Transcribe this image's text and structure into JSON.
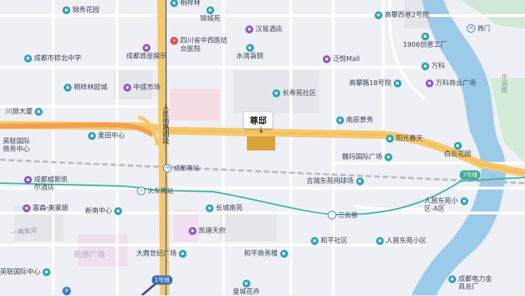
{
  "destination": {
    "label": "尊邸"
  },
  "colors": {
    "teal": "#2fa6b8",
    "purple": "#8d5ac8",
    "road": "#f6c86c",
    "metro": "#35b7a7",
    "river": "#8fc7ea"
  },
  "pois": [
    {
      "label": "锦秀花园",
      "type": "teal"
    },
    {
      "label": "桐梓林",
      "type": "teal"
    },
    {
      "label": "锦城苑",
      "type": "teal"
    },
    {
      "label": "高攀西巷2号院",
      "type": "teal"
    },
    {
      "label": "四川省中西医结合医院",
      "type": "red"
    },
    {
      "label": "汉易酒店",
      "type": "purple"
    },
    {
      "label": "成都市棕北中学",
      "type": "teal"
    },
    {
      "label": "成都首座娱乐",
      "type": "purple"
    },
    {
      "label": "水滴袅铜",
      "type": "teal"
    },
    {
      "label": "泛悦Mall",
      "type": "purple"
    },
    {
      "label": "1906创意工厂",
      "type": "teal"
    },
    {
      "label": "万科",
      "type": "teal"
    },
    {
      "label": "桐梓林欧城",
      "type": "teal"
    },
    {
      "label": "中成市场",
      "type": "purple"
    },
    {
      "label": "长寿苑社区",
      "type": "teal"
    },
    {
      "label": "高攀路18号院",
      "type": "teal"
    },
    {
      "label": "万科商业广场",
      "type": "purple"
    },
    {
      "label": "川旅大厦",
      "type": "teal"
    },
    {
      "label": "南辰景秀",
      "type": "teal"
    },
    {
      "label": "阳光春天",
      "type": "teal"
    },
    {
      "label": "麦田中心",
      "type": "teal"
    },
    {
      "label": "魏玛国际广场",
      "type": "teal"
    },
    {
      "label": "白云花园",
      "type": "teal"
    },
    {
      "label": "英联国际商务中心",
      "type": "teal"
    },
    {
      "label": "成都威斯凯尔酒店",
      "type": "purple"
    },
    {
      "label": "吉瑞东苑网球场",
      "type": "teal"
    },
    {
      "label": "富森·美家居",
      "type": "purple"
    },
    {
      "label": "新南中心",
      "type": "teal"
    },
    {
      "label": "长城南苑",
      "type": "teal"
    },
    {
      "label": "人居东苑小区-A区",
      "type": "teal"
    },
    {
      "label": "凯德天府",
      "type": "purple"
    },
    {
      "label": "和平社区",
      "type": "teal"
    },
    {
      "label": "人居东苑小区",
      "type": "teal"
    },
    {
      "label": "大鼎世纪广场",
      "type": "teal"
    },
    {
      "label": "和平商务楼",
      "type": "teal"
    },
    {
      "label": "英联国际中心",
      "type": "teal"
    },
    {
      "label": "成都电力金具总厂",
      "type": "teal"
    },
    {
      "label": "皇城花卉",
      "type": "teal"
    }
  ],
  "stations": [
    {
      "label": "成都南站"
    },
    {
      "label": "火车南站"
    },
    {
      "label": "三瓦窑"
    },
    {
      "label": "西门"
    }
  ],
  "areas": {
    "kaide": "凯德广场",
    "yijia": "一再家河",
    "huarun": "华润路"
  },
  "roads": {
    "renmin_south_4": "人民南路四段"
  },
  "lines": {
    "line7": "7号线",
    "line1": "1号线"
  }
}
